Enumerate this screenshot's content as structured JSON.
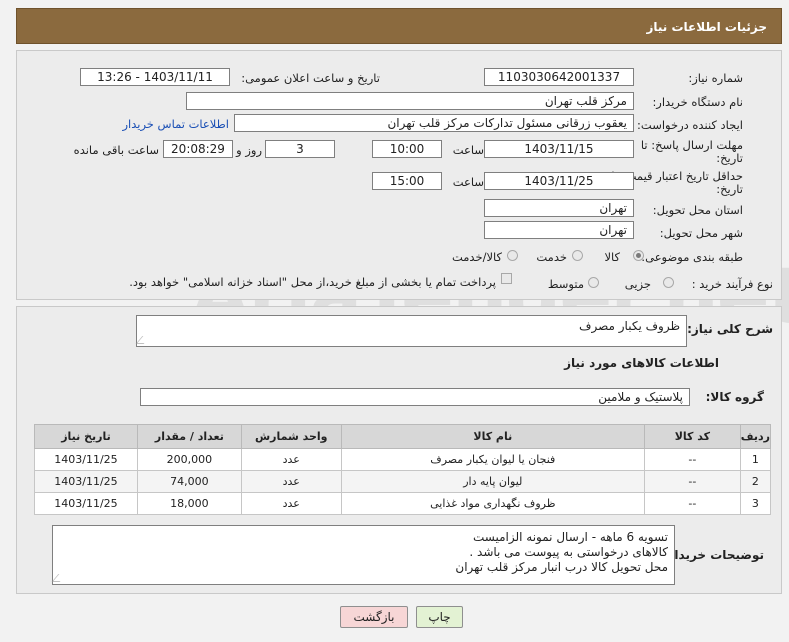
{
  "header": {
    "title": "جزئیات اطلاعات نیاز"
  },
  "form": {
    "need_number_label": "شماره نیاز:",
    "need_number": "1103030642001337",
    "announce_label": "تاریخ و ساعت اعلان عمومی:",
    "announce_value": "1403/11/11 - 13:26",
    "buyer_org_label": "نام دستگاه خریدار:",
    "buyer_org": "مرکز قلب تهران",
    "creator_label": "ایجاد کننده درخواست:",
    "creator": "یعقوب زرقانی مسئول تدارکات مرکز قلب تهران",
    "contact_link": "اطلاعات تماس خریدار",
    "reply_deadline_label_1": "مهلت ارسال پاسخ: تا",
    "reply_deadline_label_2": "تاریخ:",
    "reply_date": "1403/11/15",
    "time_label": "ساعت",
    "reply_time": "10:00",
    "days_value": "3",
    "days_label": "روز و",
    "remaining_time": "20:08:29",
    "remaining_label": "ساعت باقی مانده",
    "validity_label_1": "حداقل تاریخ اعتبار قیمت: تا",
    "validity_label_2": "تاریخ:",
    "validity_date": "1403/11/25",
    "validity_time": "15:00",
    "province_label": "استان محل تحویل:",
    "province": "تهران",
    "city_label": "شهر محل تحویل:",
    "city": "تهران",
    "category_label": "طبقه بندی موضوعی:",
    "category_options": [
      "کالا",
      "خدمت",
      "کالا/خدمت"
    ],
    "category_selected": "کالا",
    "process_label": "نوع فرآیند خرید :",
    "process_options": [
      "جزیی",
      "متوسط"
    ],
    "process_note": "پرداخت تمام یا بخشی از مبلغ خرید،از محل \"اسناد خزانه اسلامی\" خواهد بود."
  },
  "details": {
    "description_label": "شرح کلی نیاز:",
    "description": "ظروف یکبار مصرف",
    "goods_info_title": "اطلاعات کالاهای مورد نیاز",
    "goods_group_label": "گروه کالا:",
    "goods_group": "پلاستیک و ملامین",
    "table": {
      "headers": [
        "ردیف",
        "کد کالا",
        "نام کالا",
        "واحد شمارش",
        "تعداد / مقدار",
        "تاریخ نیاز"
      ],
      "rows": [
        [
          "1",
          "--",
          "فنجان یا لیوان یکبار مصرف",
          "عدد",
          "200,000",
          "1403/11/25"
        ],
        [
          "2",
          "--",
          "لیوان پایه دار",
          "عدد",
          "74,000",
          "1403/11/25"
        ],
        [
          "3",
          "--",
          "ظروف نگهداری مواد غذایی",
          "عدد",
          "18,000",
          "1403/11/25"
        ]
      ]
    },
    "buyer_notes_label": "توضیحات خریدار:",
    "buyer_notes": [
      "تسویه 6 ماهه - ارسال نمونه الزامیست",
      "کالاهای درخواستی به پیوست می باشد .",
      "محل تحویل کالا درب انبار مرکز قلب تهران"
    ]
  },
  "buttons": {
    "print": "چاپ",
    "back": "بازگشت"
  },
  "watermark": "AriaTender.net",
  "colors": {
    "header": "#8b6a3e",
    "link": "#1a4fb5",
    "back_button": "#f7d6d6",
    "print_button": "#e3f2d3"
  }
}
